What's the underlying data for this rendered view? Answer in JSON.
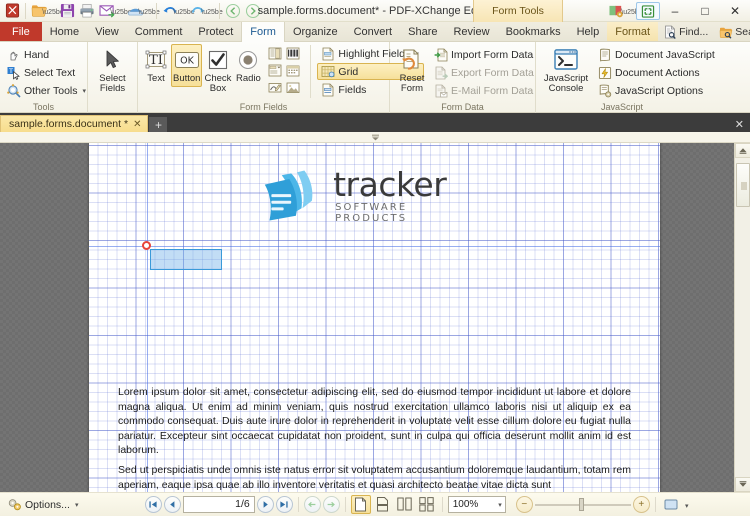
{
  "window": {
    "title": "sample.forms.document* - PDF-XChange Editor",
    "contextual_tab": "Form Tools",
    "minimize": "–",
    "maximize": "□",
    "close": "✕"
  },
  "quick_access": [
    {
      "name": "app-logo-icon",
      "label": "PDF-XChange Editor"
    },
    {
      "name": "open-icon",
      "label": "Open"
    },
    {
      "name": "save-icon",
      "label": "Save"
    },
    {
      "name": "print-icon",
      "label": "Print"
    },
    {
      "name": "email-icon",
      "label": "E-Mail"
    },
    {
      "name": "scan-icon",
      "label": "Scan"
    },
    {
      "name": "undo-icon",
      "label": "Undo"
    },
    {
      "name": "redo-icon",
      "label": "Redo"
    },
    {
      "name": "back-icon",
      "label": "Previous View"
    },
    {
      "name": "forward-icon",
      "label": "Next View"
    }
  ],
  "menu": {
    "file": "File",
    "tabs": [
      "Home",
      "View",
      "Comment",
      "Protect",
      "Form",
      "Organize",
      "Convert",
      "Share",
      "Review",
      "Bookmarks",
      "Help"
    ],
    "active_tab": "Form",
    "format_tab": "Format",
    "find": "Find...",
    "search": "Search...",
    "collapse": "˄"
  },
  "ribbon": {
    "groups": [
      {
        "title": "Tools",
        "items": [
          {
            "label": "Hand",
            "icon": "hand-icon"
          },
          {
            "label": "Select Text",
            "icon": "select-text-icon"
          },
          {
            "label": "Other Tools",
            "icon": "other-tools-icon",
            "caret": "▾"
          }
        ]
      },
      {
        "title": "",
        "items": [
          {
            "label": "Select Fields",
            "icon": "cursor-arrow-icon"
          }
        ]
      },
      {
        "title": "Form Fields",
        "items": [
          {
            "label": "Text",
            "icon": "text-field-icon"
          },
          {
            "label": "Button",
            "icon": "button-field-icon",
            "active": true
          },
          {
            "label": "Check Box",
            "icon": "check-box-field-icon"
          },
          {
            "label": "Radio",
            "icon": "radio-button-field-icon"
          }
        ],
        "mini": [
          {
            "name": "list-box-field-icon"
          },
          {
            "name": "barcode-field-icon"
          },
          {
            "name": "dropdown-field-icon"
          },
          {
            "name": "date-field-icon"
          },
          {
            "name": "signature-field-icon"
          },
          {
            "name": "image-field-icon"
          }
        ],
        "side": [
          {
            "label": "Highlight Fields",
            "icon": "highlight-fields-icon",
            "caret": "▾"
          },
          {
            "label": "Grid",
            "icon": "grid-icon",
            "active": true
          },
          {
            "label": "Fields",
            "icon": "fields-icon"
          }
        ]
      },
      {
        "title": "Form Data",
        "items": [
          {
            "label": "Reset Form",
            "icon": "reset-form-icon"
          }
        ],
        "side": [
          {
            "label": "Import Form Data",
            "icon": "import-form-data-icon"
          },
          {
            "label": "Export Form Data",
            "icon": "export-form-data-icon",
            "disabled": true
          },
          {
            "label": "E-Mail Form Data",
            "icon": "email-form-data-icon",
            "disabled": true
          }
        ]
      },
      {
        "title": "JavaScript",
        "items": [
          {
            "label": "JavaScript Console",
            "icon": "javascript-console-icon"
          }
        ],
        "side": [
          {
            "label": "Document JavaScript",
            "icon": "document-javascript-icon"
          },
          {
            "label": "Document Actions",
            "icon": "document-actions-icon"
          },
          {
            "label": "JavaScript Options",
            "icon": "javascript-options-icon"
          }
        ]
      }
    ]
  },
  "doc_tabs": {
    "items": [
      {
        "label": "sample.forms.document *",
        "close": "✕"
      }
    ],
    "new_tab": "+",
    "close_all": "✕"
  },
  "document": {
    "logo": {
      "word": "tracker",
      "tagline": "SOFTWARE PRODUCTS"
    },
    "paragraphs": [
      "Lorem ipsum dolor sit amet, consectetur adipiscing elit, sed do eiusmod tempor incididunt ut labore et dolore magna aliqua. Ut enim ad minim veniam, quis nostrud exercitation ullamco laboris nisi ut aliquip ex ea commodo consequat. Duis aute irure dolor in reprehenderit in voluptate velit esse cillum dolore eu fugiat nulla pariatur. Excepteur sint occaecat cupidatat non proident, sunt in culpa qui officia deserunt mollit anim id est laborum.",
      "Sed ut perspiciatis unde omnis iste natus error sit voluptatem accusantium doloremque laudantium, totam rem aperiam, eaque ipsa quae ab illo inventore veritatis et quasi architecto beatae vitae dicta sunt"
    ],
    "form_field": {
      "name": "push-button-field",
      "type": "Button"
    }
  },
  "status_bar": {
    "options": "Options...",
    "options_caret": "▾",
    "first_page": "❘◀",
    "prev_page": "‹",
    "page_value": "1/6",
    "next_page": "›",
    "last_page": "▶❘",
    "back": "←",
    "forward": "→",
    "view_modes": [
      {
        "name": "single-page-view-icon",
        "active": true
      },
      {
        "name": "continuous-view-icon",
        "active": false
      },
      {
        "name": "two-page-view-icon",
        "active": false
      },
      {
        "name": "two-page-continuous-view-icon",
        "active": false
      }
    ],
    "zoom_value": "100%",
    "zoom_caret": "▾",
    "zoom_out": "−",
    "zoom_in": "+",
    "fullscreen_icon": "fullscreen-icon",
    "fullscreen_caret": "▾"
  },
  "colors": {
    "accent_red": "#c0392b",
    "tab_yellow": "#f7dd8d",
    "field_blue": "#3a9ad9",
    "logo_blue": "#2fa3e0",
    "grip_red": "#e8433a"
  }
}
